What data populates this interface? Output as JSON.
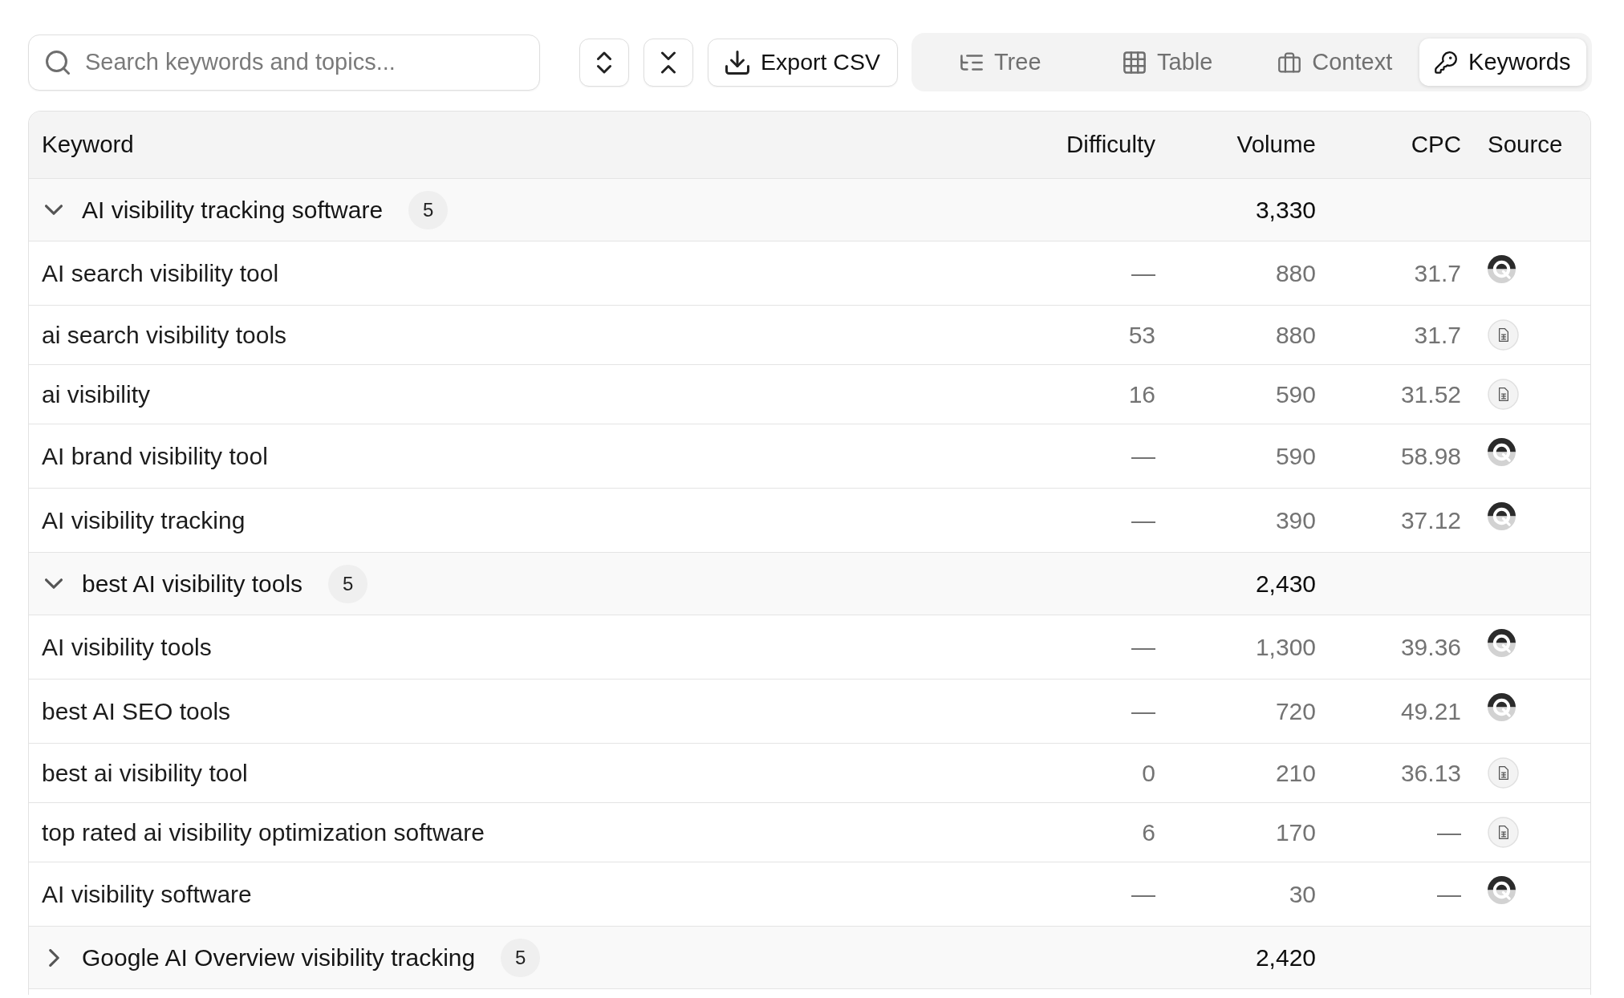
{
  "search": {
    "placeholder": "Search keywords and topics..."
  },
  "export_button": {
    "label": "Export CSV"
  },
  "view_tabs": [
    {
      "label": "Tree",
      "selected": false
    },
    {
      "label": "Table",
      "selected": false
    },
    {
      "label": "Context",
      "selected": false
    },
    {
      "label": "Keywords",
      "selected": true
    }
  ],
  "table": {
    "columns": [
      "Keyword",
      "Difficulty",
      "Volume",
      "CPC",
      "Source"
    ],
    "groups": [
      {
        "title": "AI visibility tracking software",
        "count": "5",
        "volume": "3,330",
        "expanded": true,
        "rows": [
          {
            "keyword": "AI search visibility tool",
            "difficulty": "—",
            "volume": "880",
            "cpc": "31.7",
            "kind": "logo"
          },
          {
            "keyword": "ai search visibility tools",
            "difficulty": "53",
            "volume": "880",
            "cpc": "31.7",
            "kind": "file"
          },
          {
            "keyword": "ai visibility",
            "difficulty": "16",
            "volume": "590",
            "cpc": "31.52",
            "kind": "file"
          },
          {
            "keyword": "AI brand visibility tool",
            "difficulty": "—",
            "volume": "590",
            "cpc": "58.98",
            "kind": "logo"
          },
          {
            "keyword": "AI visibility tracking",
            "difficulty": "—",
            "volume": "390",
            "cpc": "37.12",
            "kind": "logo"
          }
        ]
      },
      {
        "title": "best AI visibility tools",
        "count": "5",
        "volume": "2,430",
        "expanded": true,
        "rows": [
          {
            "keyword": "AI visibility tools",
            "difficulty": "—",
            "volume": "1,300",
            "cpc": "39.36",
            "kind": "logo"
          },
          {
            "keyword": "best AI SEO tools",
            "difficulty": "—",
            "volume": "720",
            "cpc": "49.21",
            "kind": "logo"
          },
          {
            "keyword": "best ai visibility tool",
            "difficulty": "0",
            "volume": "210",
            "cpc": "36.13",
            "kind": "file"
          },
          {
            "keyword": "top rated ai visibility optimization software",
            "difficulty": "6",
            "volume": "170",
            "cpc": "—",
            "kind": "file"
          },
          {
            "keyword": "AI visibility software",
            "difficulty": "—",
            "volume": "30",
            "cpc": "—",
            "kind": "logo"
          }
        ]
      },
      {
        "title": "Google AI Overview visibility tracking",
        "count": "5",
        "volume": "2,420",
        "expanded": false
      }
    ]
  }
}
